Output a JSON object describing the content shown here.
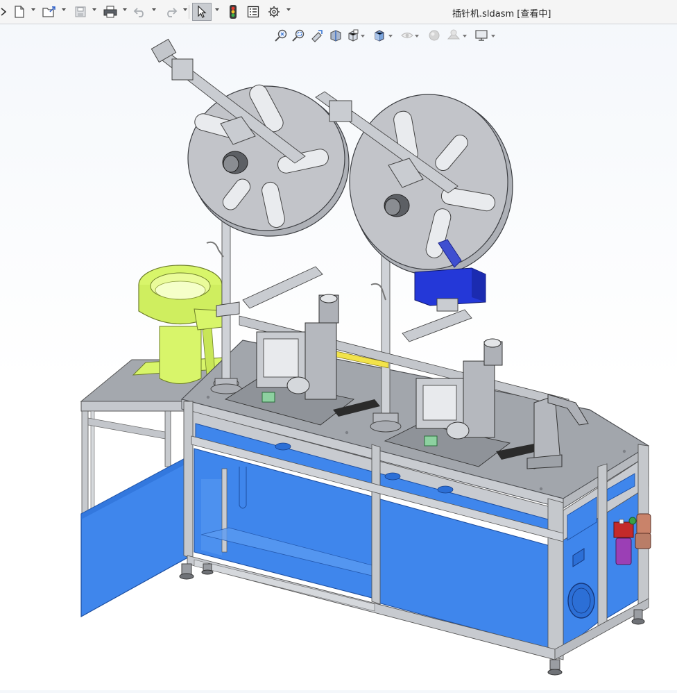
{
  "window": {
    "title": "插针机.sldasm [查看中]"
  },
  "toolbar": {
    "items": [
      {
        "name": "new-document",
        "icon": "page-icon",
        "has_dropdown": true
      },
      {
        "name": "open-document",
        "icon": "folder-open-icon",
        "has_dropdown": true
      },
      {
        "name": "save-document",
        "icon": "floppy-icon",
        "has_dropdown": true,
        "disabled": true
      },
      {
        "name": "print",
        "icon": "printer-icon",
        "has_dropdown": true
      },
      {
        "name": "undo",
        "icon": "undo-icon",
        "has_dropdown": true,
        "disabled": true
      },
      {
        "name": "redo",
        "icon": "redo-icon",
        "has_dropdown": true,
        "disabled": true
      },
      {
        "name": "select",
        "icon": "cursor-arrow-icon",
        "has_dropdown": true,
        "active": true
      },
      {
        "name": "rebuild",
        "icon": "traffic-light-icon"
      },
      {
        "name": "file-properties",
        "icon": "list-icon"
      },
      {
        "name": "options",
        "icon": "gear-icon",
        "has_dropdown": true
      }
    ]
  },
  "view_toolbar": {
    "items": [
      {
        "name": "zoom-to-fit",
        "icon": "magnifier-fit-icon"
      },
      {
        "name": "zoom-to-area",
        "icon": "magnifier-area-icon"
      },
      {
        "name": "previous-view",
        "icon": "previous-view-icon"
      },
      {
        "name": "section-view",
        "icon": "section-view-icon"
      },
      {
        "name": "view-orientation",
        "icon": "cube-orientation-icon",
        "has_dropdown": true
      },
      {
        "name": "display-style",
        "icon": "shaded-cube-icon",
        "has_dropdown": true
      },
      {
        "name": "hide-show-items",
        "icon": "eye-icon",
        "has_dropdown": true,
        "disabled": true
      },
      {
        "name": "edit-appearance",
        "icon": "sphere-icon",
        "disabled": true
      },
      {
        "name": "apply-scene",
        "icon": "scene-icon",
        "has_dropdown": true,
        "disabled": true
      },
      {
        "name": "view-settings",
        "icon": "monitor-icon",
        "has_dropdown": true
      }
    ]
  },
  "model": {
    "name": "插针机",
    "colors": {
      "panel_blue": "#3f86ec",
      "panel_blue_dark": "#2c6fd6",
      "frame_gray": "#b9bcc2",
      "table_top": "#9ea2a8",
      "reel_gray": "#c2c4c9",
      "feeder_yellow": "#d8f56a",
      "motor_blue": "#2438d8",
      "filter_red": "#c42a2a",
      "filter_purple": "#9b3fb5"
    }
  }
}
